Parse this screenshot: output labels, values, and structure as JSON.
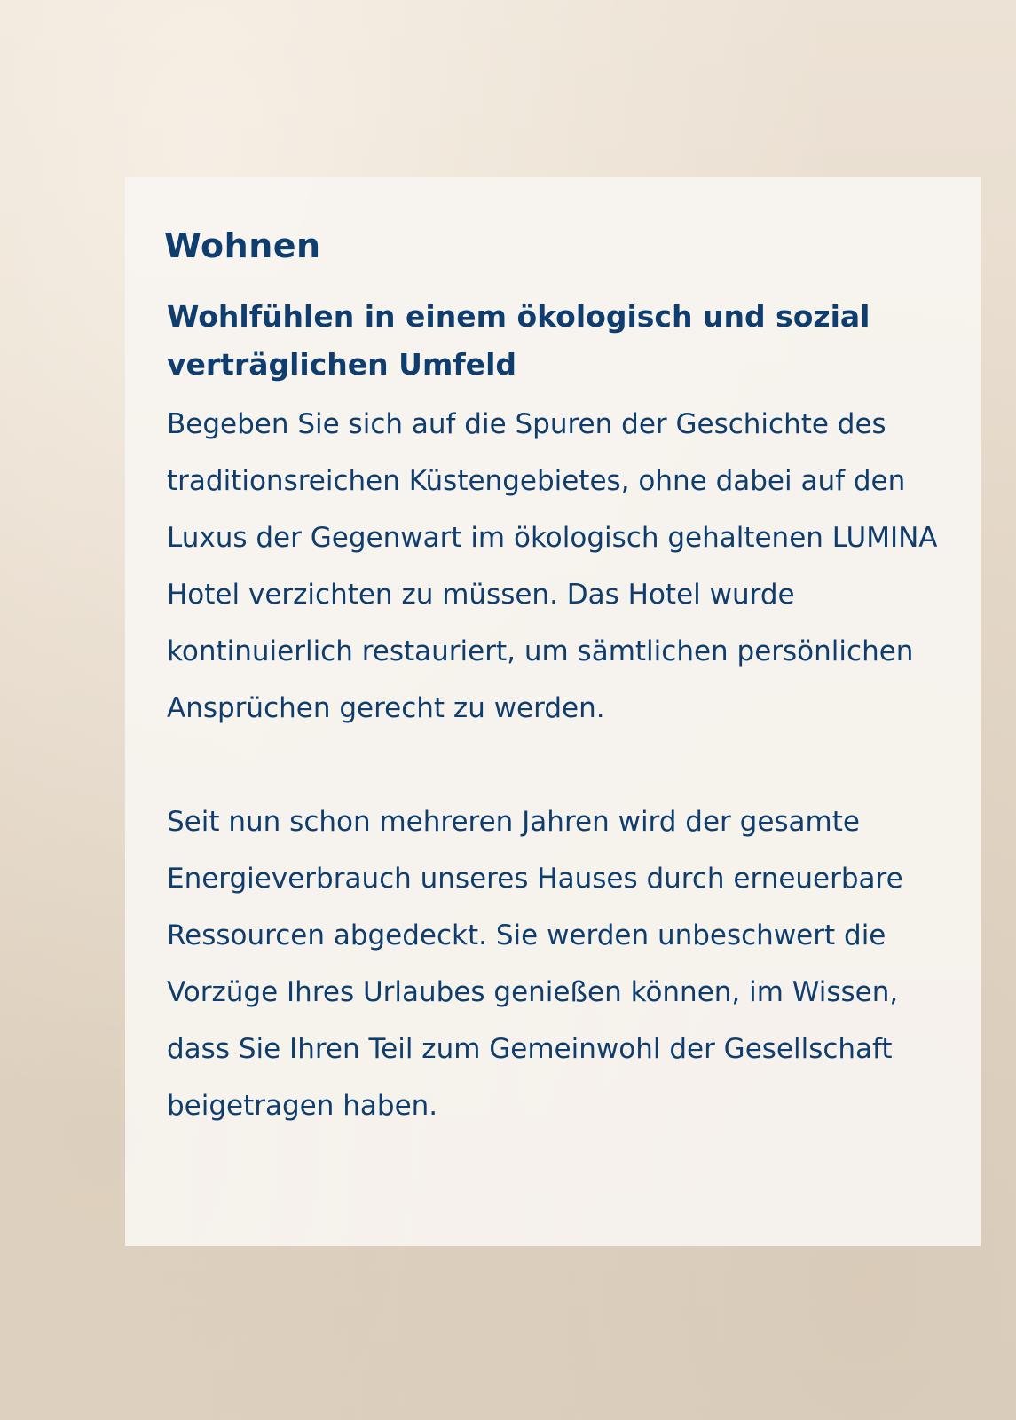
{
  "section": {
    "title": "Wohnen",
    "subtitle": "Wohlfühlen in einem ökologisch und sozial verträglichen Umfeld",
    "paragraphs": [
      "Begeben Sie sich auf die Spuren der Geschichte des traditionsreichen Küstengebietes, ohne dabei auf den Luxus der Gegenwart im ökologisch gehaltenen LUMINA Hotel verzichten zu müssen. Das Hotel wurde kontinuierlich restauriert, um sämtlichen persönlichen Ansprüchen gerecht zu werden.",
      "Seit nun schon mehreren Jahren wird der gesamte Energieverbrauch unseres Hauses durch erneuerbare Ressourcen abgedeckt. Sie werden unbeschwert  die Vorzüge Ihres Urlaubes genießen können, im Wissen, dass Sie Ihren Teil zum Gemeinwohl der Gesellschaft beigetragen haben."
    ]
  },
  "colors": {
    "text": "#0f3d6e",
    "panel": "#f7f4f0",
    "background": "#e6dacb"
  }
}
